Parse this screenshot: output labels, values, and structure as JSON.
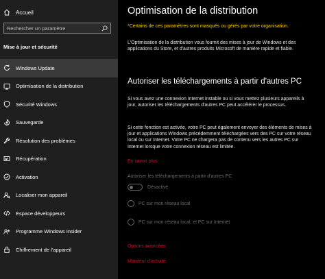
{
  "sidebar": {
    "home_label": "Accueil",
    "search_placeholder": "Rechercher un paramètre",
    "section_title": "Mise à jour et sécurité",
    "items": [
      {
        "label": "Windows Update",
        "icon": "refresh-icon"
      },
      {
        "label": "Optimisation de la distribution",
        "icon": "delivery-optimization-icon"
      },
      {
        "label": "Sécurité Windows",
        "icon": "shield-icon"
      },
      {
        "label": "Sauvegarde",
        "icon": "backup-arrow-icon"
      },
      {
        "label": "Résolution des problèmes",
        "icon": "wrench-icon"
      },
      {
        "label": "Récupération",
        "icon": "recovery-icon"
      },
      {
        "label": "Activation",
        "icon": "activation-check-icon"
      },
      {
        "label": "Localiser mon appareil",
        "icon": "locate-person-icon"
      },
      {
        "label": "Espace développeurs",
        "icon": "developer-icon"
      },
      {
        "label": "Programme Windows Insider",
        "icon": "insider-icon"
      },
      {
        "label": "Chiffrement de l'appareil",
        "icon": "lock-icon"
      }
    ]
  },
  "main": {
    "title": "Optimisation de la distribution",
    "warning": "*Certains de ces paramètres sont masqués ou gérés par votre organisation.",
    "intro": "L'Optimisation de la distribution vous fournit des mises à jour de Windows et des applications du Store, et d'autres produits Microsoft de manière rapide et fiable.",
    "section_heading": "Autoriser les téléchargements à partir d'autres PC",
    "para1": "Si vous avez une connexion Internet instable ou si vous mettez plusieurs appareils à jour, autoriser les téléchargements d'autres PC peut accélérer le processus.",
    "para2": "Si cette fonction est activée, votre PC peut également envoyer des éléments de mises à jour et applications Windows précédemment téléchargées vers des PC sur votre réseau local ou sur Internet. Votre PC ne chargera pas de contenu vers les autres PC sur Internet lorsque votre connexion réseau est limitée.",
    "learn_more": "En savoir plus",
    "toggle_label": "Autoriser les téléchargements à partir d'autres PC",
    "toggle_state": "Désactivé",
    "radio1": "PC sur mon réseau local",
    "radio2": "PC sur mon réseau local, et PC sur Internet",
    "advanced_options": "Options avancées",
    "activity_monitor": "Moniteur d'activité"
  },
  "colors": {
    "warning": "#ffd200",
    "link": "#c8102e",
    "disabled": "#6b6b6b"
  }
}
